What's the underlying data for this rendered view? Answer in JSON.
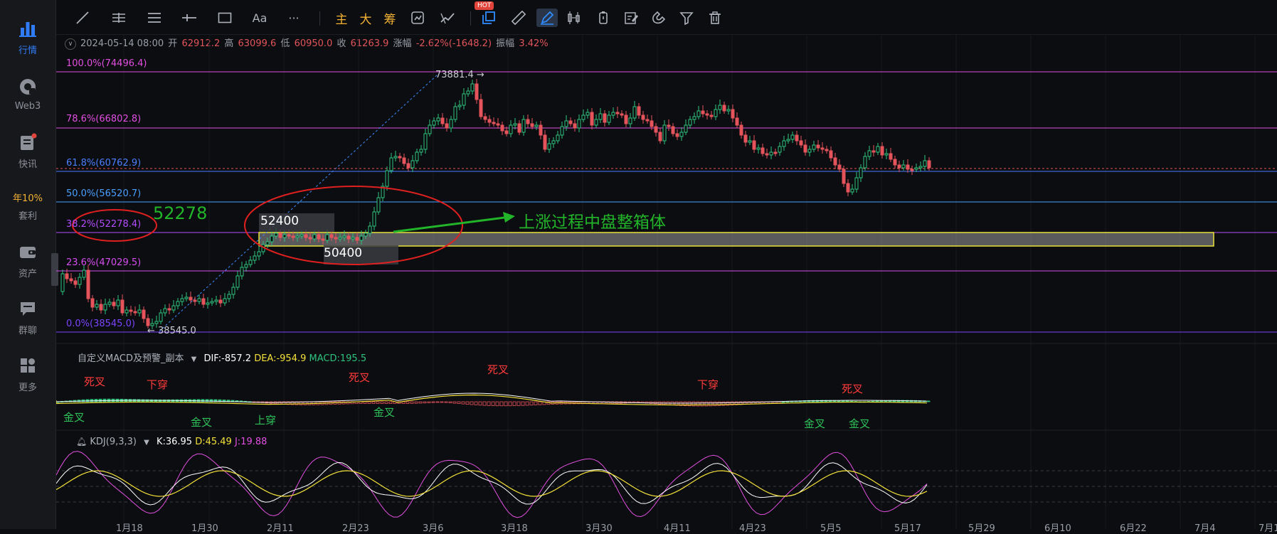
{
  "sidebar": {
    "items": [
      {
        "label": "行情",
        "icon": "bar-chart-icon",
        "active": true
      },
      {
        "label": "Web3",
        "icon": "web3-icon"
      },
      {
        "label": "快讯",
        "icon": "news-icon"
      },
      {
        "label": "套利",
        "badge": "年10%"
      },
      {
        "label": "资产",
        "icon": "wallet-icon"
      },
      {
        "label": "群聊",
        "icon": "chat-icon"
      },
      {
        "label": "更多",
        "icon": "grid-icon"
      }
    ]
  },
  "toolbar": {
    "font_tool": "Aa",
    "more_tool": "···",
    "main_label": "主",
    "big_label": "大",
    "chip_label": "筹",
    "hot_badge": "HOT"
  },
  "ohlc": {
    "date": "2024-05-14 08:00",
    "open_label": "开",
    "open": "62912.2",
    "high_label": "高",
    "high": "63099.6",
    "low_label": "低",
    "low": "60950.0",
    "close_label": "收",
    "close": "61263.9",
    "change_label": "涨幅",
    "change": "-2.62%(-1648.2)",
    "amp_label": "振幅",
    "amp": "3.42%"
  },
  "fib": [
    {
      "label": "100.0%(74496.4)",
      "color": "#e14fe0"
    },
    {
      "label": "78.6%(66802.8)",
      "color": "#e14fe0"
    },
    {
      "label": "61.8%(60762.9)",
      "color": "#4a7fff"
    },
    {
      "label": "50.0%(56520.7)",
      "color": "#4a9fff"
    },
    {
      "label": "38.2%(52278.4)",
      "color": "#b44dff"
    },
    {
      "label": "23.6%(47029.5)",
      "color": "#d64df0"
    },
    {
      "label": "0.0%(38545.0)",
      "color": "#7a44ff"
    }
  ],
  "annotations": {
    "high_mark": "73881.4",
    "low_mark": "38545.0",
    "box_top": "52400",
    "box_bottom": "50400",
    "fib_note": "52278",
    "box_note": "上涨过程中盘整箱体"
  },
  "macd": {
    "title": "自定义MACD及预警_副本",
    "dif": "DIF:-857.2",
    "dea": "DEA:-954.9",
    "macd": "MACD:195.5",
    "signals": {
      "dead1": "死叉",
      "down1": "下穿",
      "dead2": "死叉",
      "dead3": "死叉",
      "down2": "下穿",
      "dead4": "死叉",
      "gold1": "金叉",
      "gold2": "金叉",
      "up1": "上穿",
      "gold3": "金叉",
      "gold4": "金叉",
      "gold5": "金叉"
    }
  },
  "kdj": {
    "title": "KDJ(9,3,3)",
    "k": "K:36.95",
    "d": "D:45.49",
    "j": "J:19.88"
  },
  "xaxis": {
    "dates": [
      "1月18",
      "1月30",
      "2月11",
      "2月23",
      "3月6",
      "3月18",
      "3月30",
      "4月11",
      "4月23",
      "5月5",
      "5月17",
      "5月29",
      "6月10",
      "6月22",
      "7月4",
      "7月1"
    ]
  },
  "colors": {
    "up": "#2ec27e",
    "down": "#e5535b",
    "box_fill": "#9a9a9a",
    "box_border": "#e8e23a",
    "annotation_red": "#e02020",
    "annotation_green": "#22b52a"
  }
}
